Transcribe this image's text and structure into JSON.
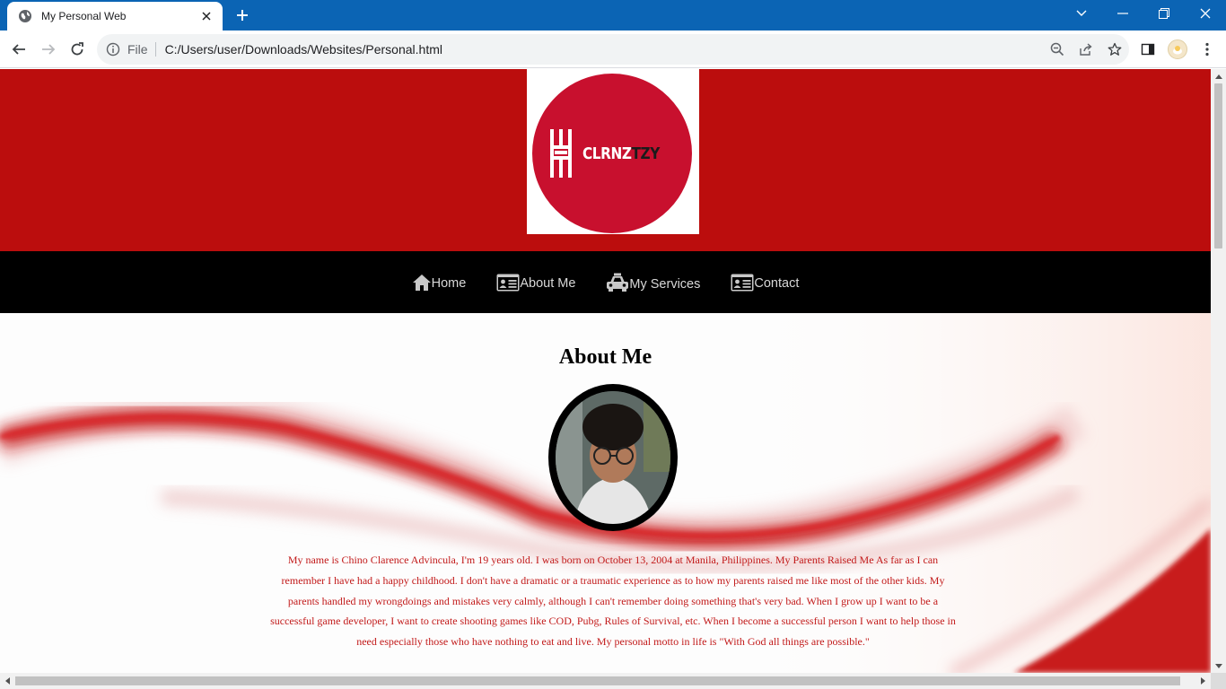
{
  "browser": {
    "tab_title": "My Personal Web",
    "omnibox_label": "File",
    "url": "C:/Users/user/Downloads/Websites/Personal.html"
  },
  "site": {
    "logo": {
      "text_white": "CLRNZ",
      "text_dark": "TZY",
      "circle_color": "#c8102e"
    },
    "header_color": "#bb0d0d",
    "nav": [
      {
        "label": "Home",
        "icon": "home-icon"
      },
      {
        "label": "About Me",
        "icon": "id-card-icon"
      },
      {
        "label": "My Services",
        "icon": "taxi-icon"
      },
      {
        "label": "Contact",
        "icon": "contact-card-icon"
      }
    ],
    "about": {
      "title": "About Me",
      "paragraph": "My name is Chino Clarence Advincula, I'm 19 years old. I was born on October 13, 2004 at Manila, Philippines. My Parents Raised Me As far as I can remember I have had a happy childhood. I don't have a dramatic or a traumatic experience as to how my parents raised me like most of the other kids. My parents handled my wrongdoings and mistakes very calmly, although I can't remember doing something that's very bad. When I grow up I want to be a successful game developer, I want to create shooting games like COD, Pubg, Rules of Survival, etc. When I become a successful person I want to help those in need especially those who have nothing to eat and live. My personal motto in life is \"With God all things are possible.\""
    }
  }
}
